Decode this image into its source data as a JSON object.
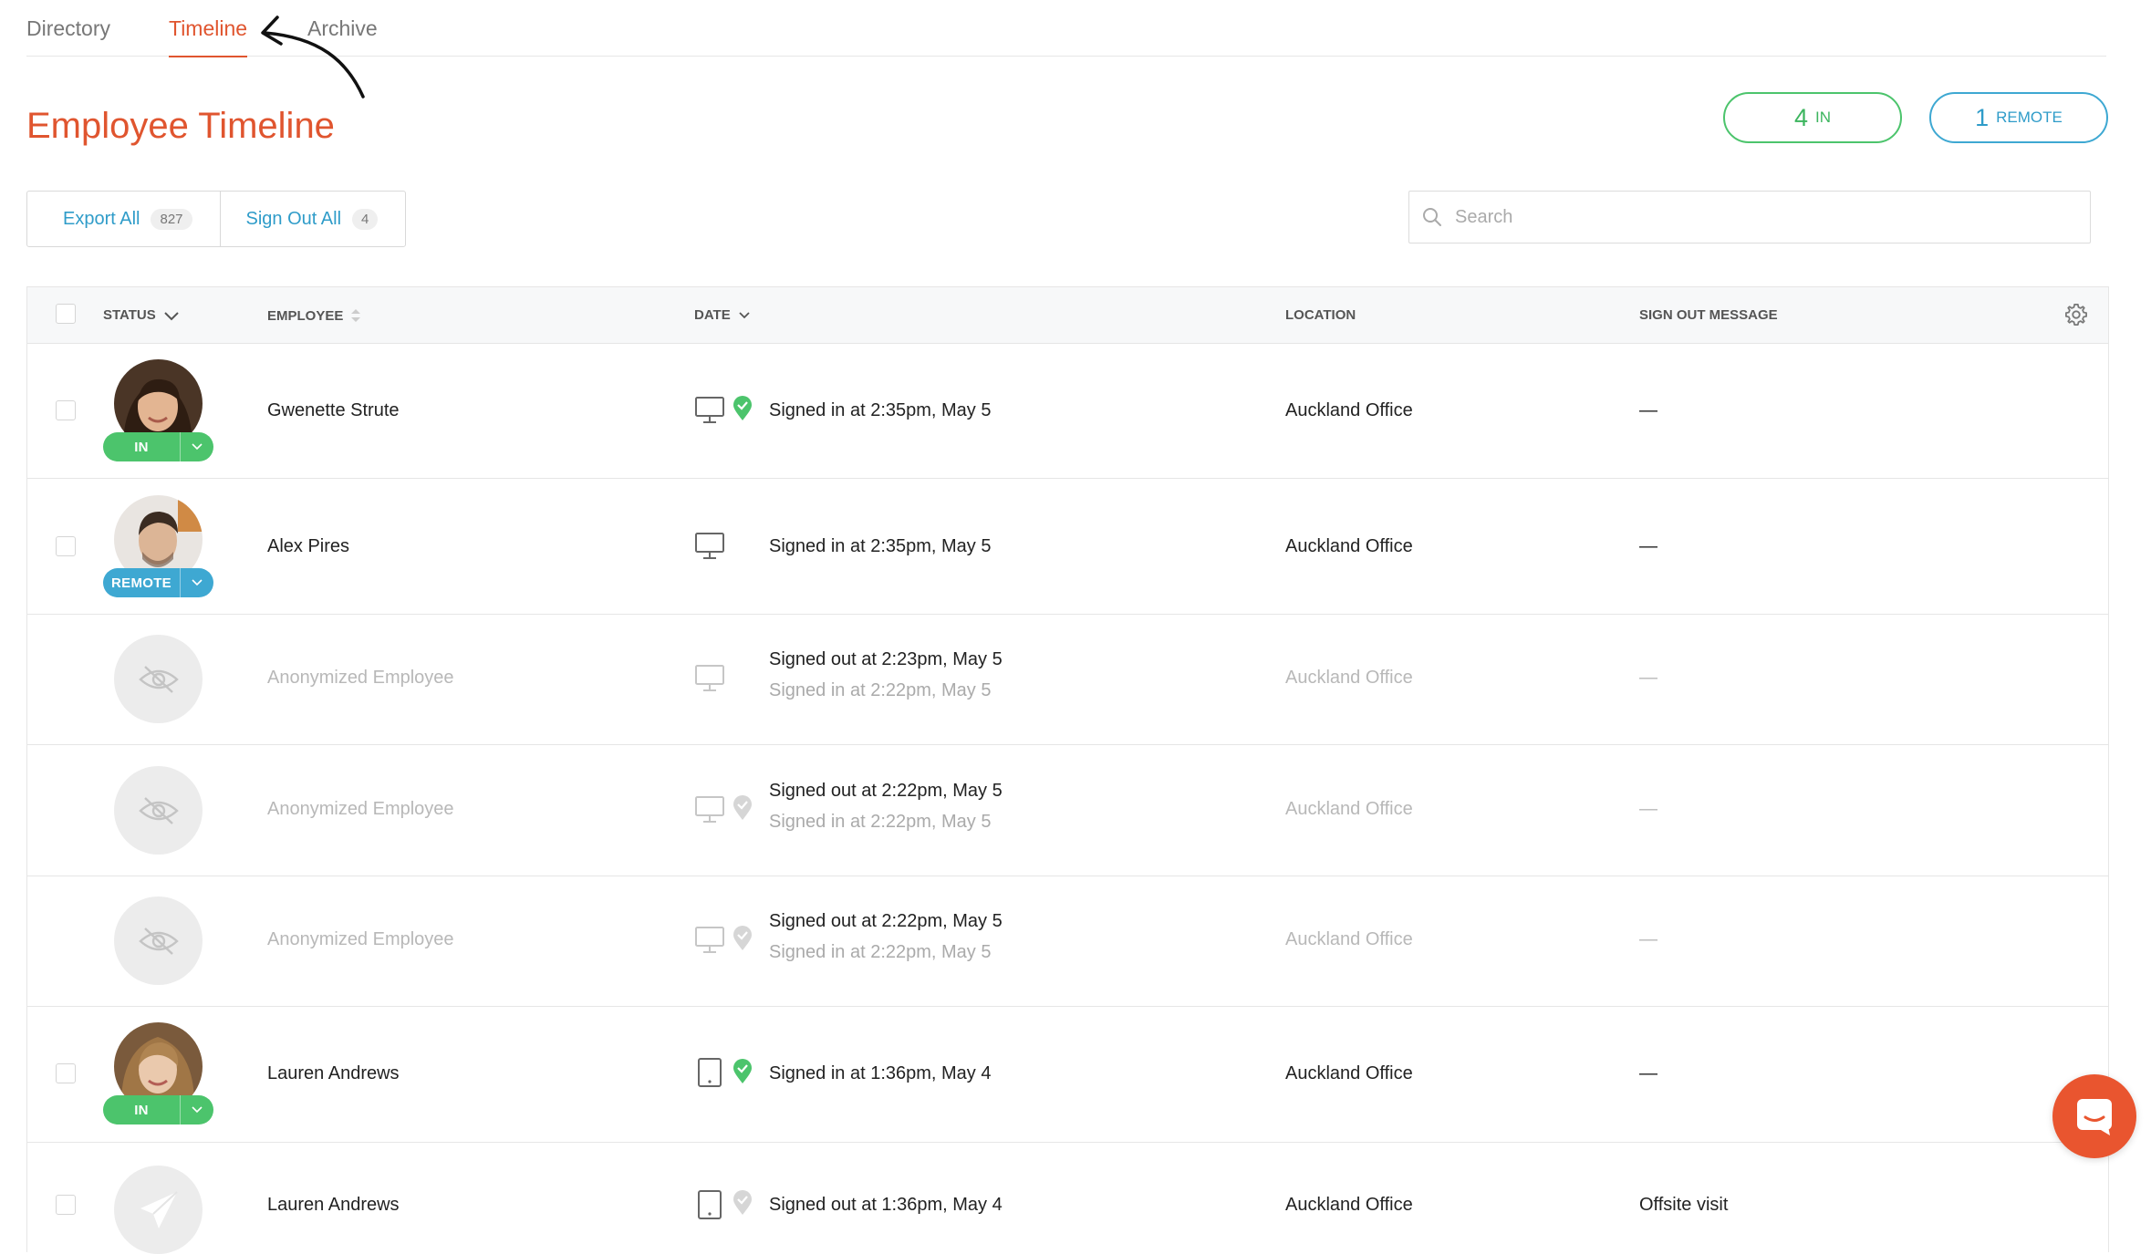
{
  "tabs": [
    {
      "label": "Directory",
      "active": false
    },
    {
      "label": "Timeline",
      "active": true
    },
    {
      "label": "Archive",
      "active": false
    }
  ],
  "page_title": "Employee Timeline",
  "summary": {
    "in_count": "4",
    "in_label": "IN",
    "remote_count": "1",
    "remote_label": "REMOTE"
  },
  "actions": {
    "export_label": "Export All",
    "export_count": "827",
    "signout_label": "Sign Out All",
    "signout_count": "4"
  },
  "search": {
    "placeholder": "Search",
    "value": ""
  },
  "table": {
    "headers": {
      "status": "STATUS",
      "employee": "EMPLOYEE",
      "date": "DATE",
      "location": "LOCATION",
      "message": "SIGN OUT MESSAGE"
    },
    "rows": [
      {
        "name": "Gwenette Strute",
        "badge": "IN",
        "device": "desktop-icon",
        "pin": "green",
        "date_primary": "Signed in at 2:35pm, May 5",
        "date_secondary": "",
        "location": "Auckland Office",
        "message": "—"
      },
      {
        "name": "Alex Pires",
        "badge": "REMOTE",
        "device": "desktop-icon",
        "pin": "none",
        "date_primary": "Signed in at 2:35pm, May 5",
        "date_secondary": "",
        "location": "Auckland Office",
        "message": "—"
      },
      {
        "name": "Anonymized Employee",
        "badge": "",
        "device": "desktop-icon",
        "pin": "none",
        "date_primary": "Signed out at 2:23pm, May 5",
        "date_secondary": "Signed in at 2:22pm, May 5",
        "location": "Auckland Office",
        "message": "—"
      },
      {
        "name": "Anonymized Employee",
        "badge": "",
        "device": "desktop-icon",
        "pin": "grey",
        "date_primary": "Signed out at 2:22pm, May 5",
        "date_secondary": "Signed in at 2:22pm, May 5",
        "location": "Auckland Office",
        "message": "—"
      },
      {
        "name": "Anonymized Employee",
        "badge": "",
        "device": "desktop-icon",
        "pin": "grey",
        "date_primary": "Signed out at 2:22pm, May 5",
        "date_secondary": "Signed in at 2:22pm, May 5",
        "location": "Auckland Office",
        "message": "—"
      },
      {
        "name": "Lauren Andrews",
        "badge": "IN",
        "device": "tablet-icon",
        "pin": "green",
        "date_primary": "Signed in at 1:36pm, May 4",
        "date_secondary": "",
        "location": "Auckland Office",
        "message": "—"
      },
      {
        "name": "Lauren Andrews",
        "badge": "",
        "device": "tablet-icon",
        "pin": "grey",
        "date_primary": "Signed out at 1:36pm, May 4",
        "date_secondary": "",
        "location": "Auckland Office",
        "message": "Offsite visit"
      }
    ]
  },
  "colors": {
    "accent": "#e0552f",
    "in": "#4cc46c",
    "remote": "#3ea8d2",
    "link": "#2f9cc9"
  }
}
